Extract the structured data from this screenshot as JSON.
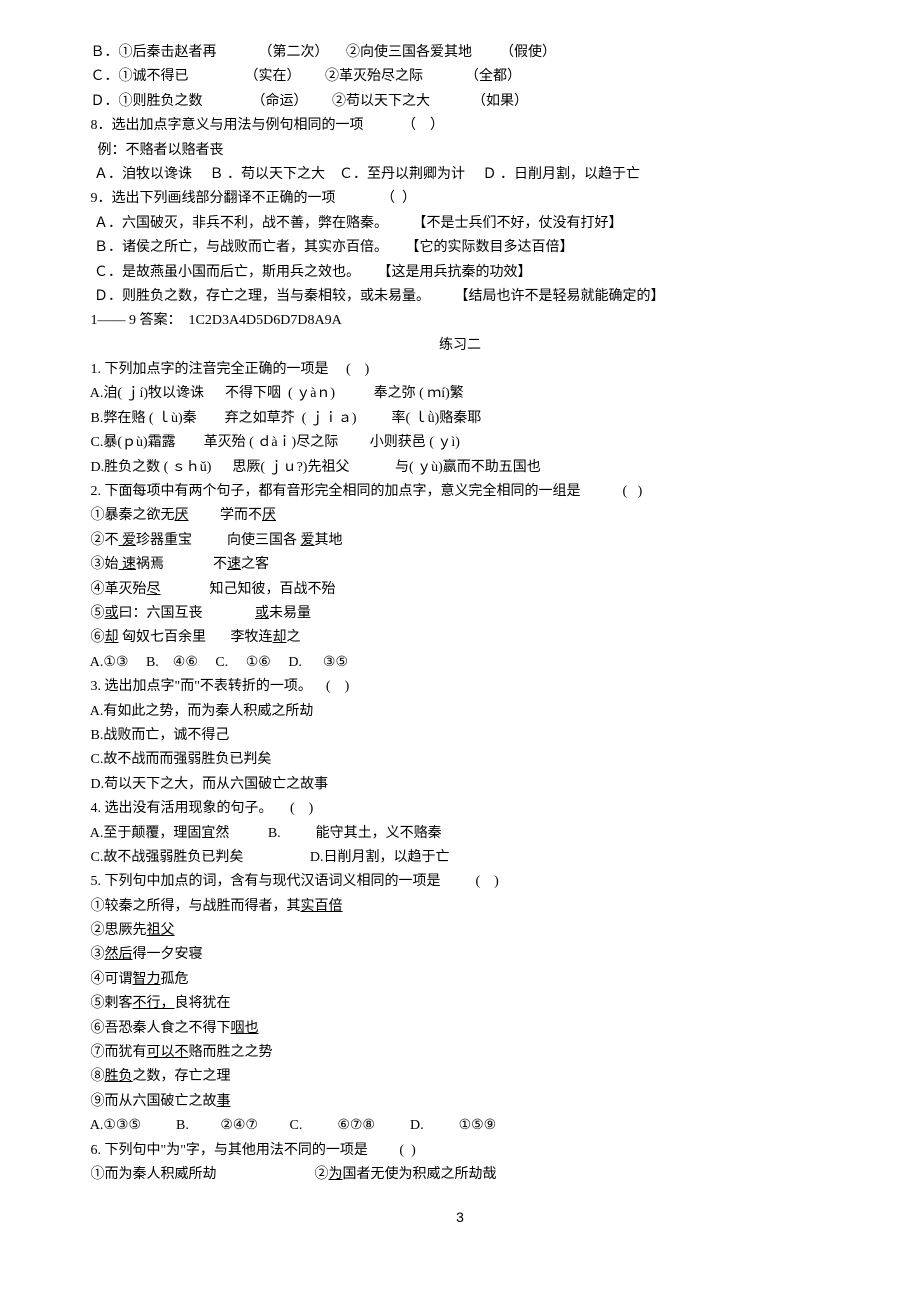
{
  "lines": [
    {
      "text": "   Ｂ．①后秦击赵者再            （第二次）     ②向使三国各爱其地        （假使）"
    },
    {
      "text": "   Ｃ．①诚不得已                （实在）       ②革灭殆尽之际            （全都）"
    },
    {
      "text": "   Ｄ．①则胜负之数              （命运）       ②苟以天下之大            （如果）"
    },
    {
      "text": "   8．选出加点字意义与用法与例句相同的一项           （    ）"
    },
    {
      "text": "     例：不赂者以赂者丧"
    },
    {
      "text": "    Ａ．洎牧以谗诛     Ｂ ．苟以天下之大    Ｃ．至丹以荆卿为计     Ｄ ．日削月割，以趋于亡"
    },
    {
      "text": "   9．选出下列画线部分翻译不正确的一项             （  ）"
    },
    {
      "text": "    Ａ．六国破灭，非兵不利，战不善，弊在赂秦。       【不是士兵们不好，仗没有打好】"
    },
    {
      "text": "    Ｂ．诸侯之所亡，与战败而亡者，其实亦百倍。     【它的实际数目多达百倍】"
    },
    {
      "text": "    Ｃ．是故燕虽小国而后亡，斯用兵之效也。     【这是用兵抗秦的功效】"
    },
    {
      "text": "    Ｄ．则胜负之数，存亡之理，当与秦相较，或未易量。       【结局也许不是轻易就能确定的】"
    },
    {
      "text": "   1—— 9 答案：  1C2D3A4D5D6D7D8A9A"
    },
    {
      "text": "练习二",
      "center": true
    },
    {
      "text": "   1. 下列加点字的注音完全正确的一项是     (    )"
    },
    {
      "text": "   A.洎( ｊí)牧以谗诛      不得下咽  ( ｙàｎ)           奉之弥 ( ｍí)繁"
    },
    {
      "text": "   B.弊在赂 ( ｌù)秦        弃之如草芥  ( ｊｉａ)          率( ｌǜ)赂秦耶"
    },
    {
      "text": "   C.暴(ｐù)霜露        革灭殆 ( ｄàｉ)尽之际         小则获邑 ( ｙì)"
    },
    {
      "text": "   D.胜负之数 ( ｓｈǔ)      思厥( ｊｕ?)先祖父             与( ｙù)嬴而不助五国也"
    },
    {
      "text": "   2. 下面每项中有两个句子，都有音形完全相同的加点字，意义完全相同的一组是            (   )"
    },
    {
      "html": "   ①暴秦之欲无<span class='underline'>厌</span>         学而不<span class='underline'>厌</span>"
    },
    {
      "html": "   ②不<span class='underline'> 爱</span>珍器重宝          向使三国各 <span class='underline'>爱</span>其地"
    },
    {
      "html": "   ③始<span class='underline'> 速</span>祸焉              不<span class='underline'>速</span>之客"
    },
    {
      "html": "   ④革灭殆<span class='underline'>尽</span>              知己知彼，百战不殆"
    },
    {
      "html": "   ⑤<span class='underline'>或</span>曰：六国互丧               <span class='underline'>或</span>未易量"
    },
    {
      "html": "   ⑥<span class='underline'>却</span> 匈奴七百余里       李牧连<span class='underline'>却</span>之"
    },
    {
      "text": "   A.①③     B.    ④⑥     C.     ①⑥     D.      ③⑤"
    },
    {
      "text": "   3. 选出加点字\"而\"不表转折的一项。    (    )"
    },
    {
      "text": "   A.有如此之势，而为秦人积威之所劫"
    },
    {
      "text": "   B.战败而亡，诚不得己"
    },
    {
      "text": "   C.故不战而而强弱胜负已判矣"
    },
    {
      "text": "   D.苟以天下之大，而从六国破亡之故事"
    },
    {
      "text": "   4. 选出没有活用现象的句子。     (    )"
    },
    {
      "text": "   A.至于颠覆，理固宜然           B.          能守其土，义不赂秦"
    },
    {
      "text": "   C.故不战强弱胜负已判矣                   D.日削月割，以趋于亡"
    },
    {
      "text": "   5. 下列句中加点的词，含有与现代汉语词义相同的一项是          (    )"
    },
    {
      "html": "   ①较秦之所得，与战胜而得者，其<span class='underline'>实百倍</span>"
    },
    {
      "html": "   ②思厥先<span class='underline'>祖父</span>"
    },
    {
      "html": "   ③<span class='underline'>然后</span>得一夕安寝"
    },
    {
      "html": "   ④可谓<span class='underline'>智力</span>孤危"
    },
    {
      "html": "   ⑤剌客<span class='underline'>不行，</span>良将犹在"
    },
    {
      "html": "   ⑥吾恐秦人食之不得下<span class='underline'>咽也</span>"
    },
    {
      "html": "   ⑦而犹有<span class='underline'>可以不</span>赂而胜之之势"
    },
    {
      "html": "   ⑧<span class='underline'>胜负</span>之数，存亡之理"
    },
    {
      "html": "   ⑨而从六国破亡之故<span class='underline'>事</span>"
    },
    {
      "text": "   A.①③⑤          B.         ②④⑦         C.          ⑥⑦⑧          D.          ①⑤⑨"
    },
    {
      "text": "   6. 下列句中\"为\"字，与其他用法不同的一项是         (  )"
    },
    {
      "html": "   ①而为秦人积威所劫                            ②<span class='underline'>为</span>国者无使为积威之所劫哉"
    }
  ],
  "page_number": "3"
}
